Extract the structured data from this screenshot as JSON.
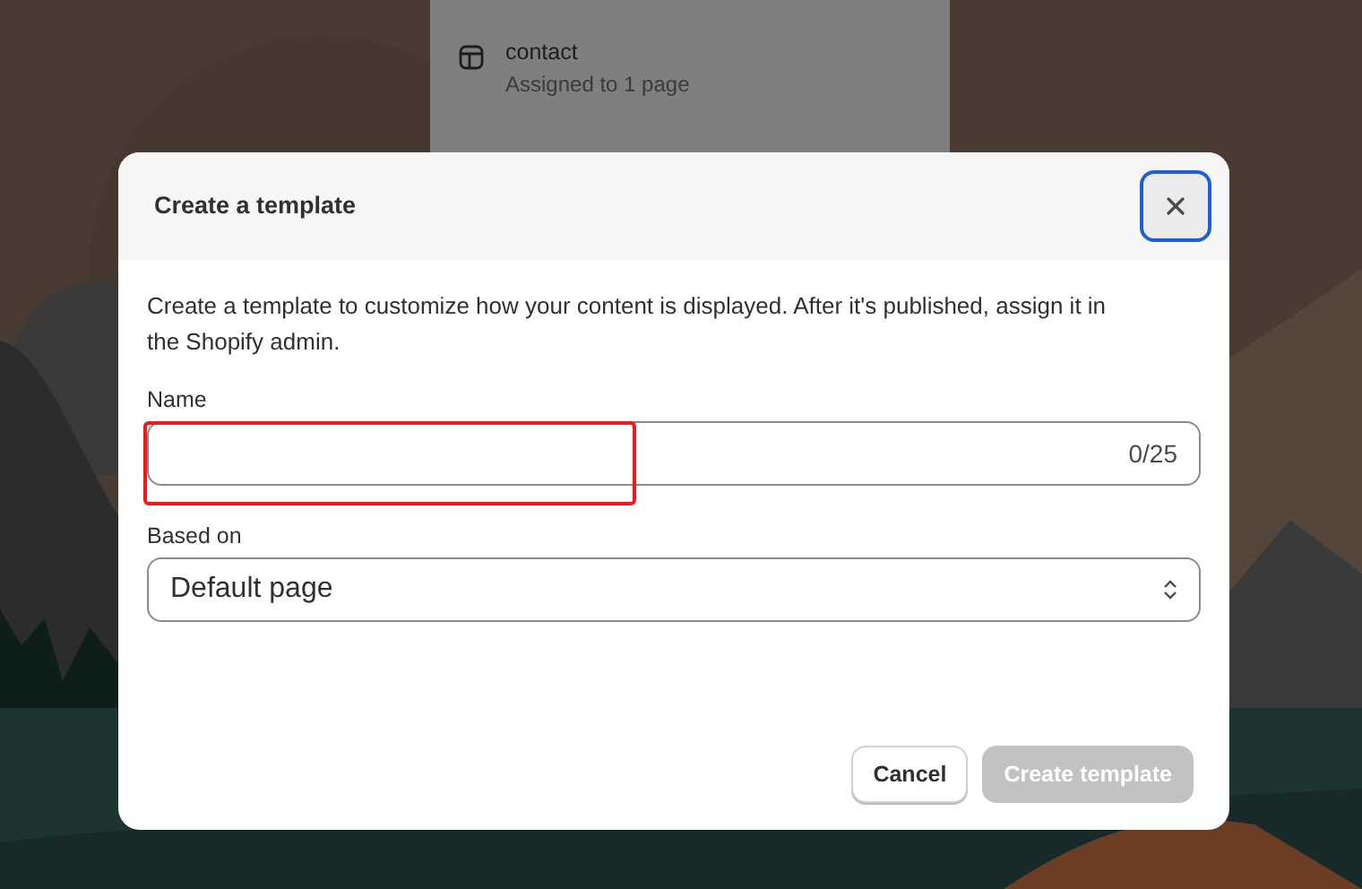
{
  "background_panel": {
    "items": [
      {
        "title": "contact",
        "subtitle": "Assigned to 1 page"
      }
    ]
  },
  "dialog": {
    "title": "Create a template",
    "description": "Create a template to customize how your content is displayed. After it's published, assign it in the Shopify admin.",
    "fields": [
      {
        "kind": "text",
        "label": "Name",
        "counter": "0/25"
      },
      {
        "kind": "select",
        "label": "Based on",
        "value": "Default page"
      }
    ],
    "buttons": [
      {
        "label": "Cancel",
        "kind": "secondary",
        "disabled": false
      },
      {
        "label": "Create template",
        "kind": "primary",
        "disabled": true
      }
    ]
  }
}
